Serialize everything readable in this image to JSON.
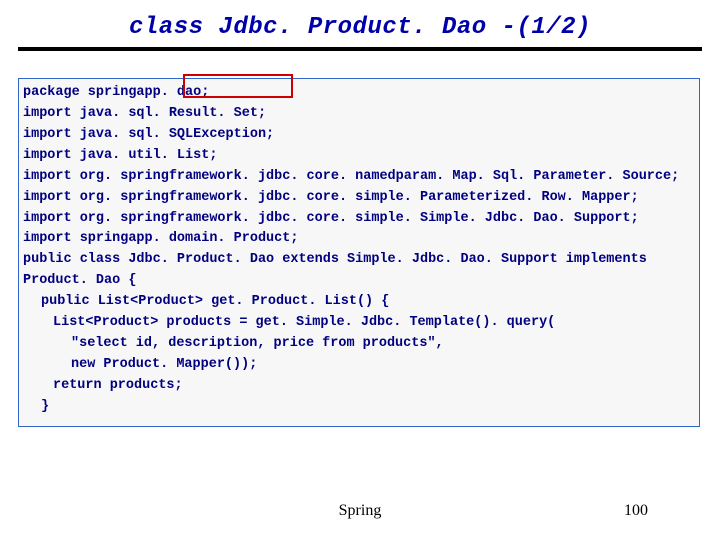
{
  "title": "class Jdbc. Product. Dao -(1/2)",
  "code": {
    "l0": "package springapp. dao;",
    "l1": "import java. sql. Result. Set;",
    "l2": "import java. sql. SQLException;",
    "l3": "import java. util. List;",
    "l4": "import org. springframework. jdbc. core. namedparam. Map. Sql. Parameter. Source;",
    "l5": "import org. springframework. jdbc. core. simple. Parameterized. Row. Mapper;",
    "l6": "import org. springframework. jdbc. core. simple. Simple. Jdbc. Dao. Support;",
    "l7": "import springapp. domain. Product;",
    "l8": "public class Jdbc. Product. Dao extends Simple. Jdbc. Dao. Support implements",
    "l9": "Product. Dao {",
    "l10": "public List<Product> get. Product. List() {",
    "l11": "List<Product> products = get. Simple. Jdbc. Template(). query(",
    "l12": "\"select id, description, price from products\",",
    "l13": "new Product. Mapper());",
    "l14": "return products;",
    "l15": "}"
  },
  "footer": {
    "label": "Spring",
    "page": "100"
  }
}
